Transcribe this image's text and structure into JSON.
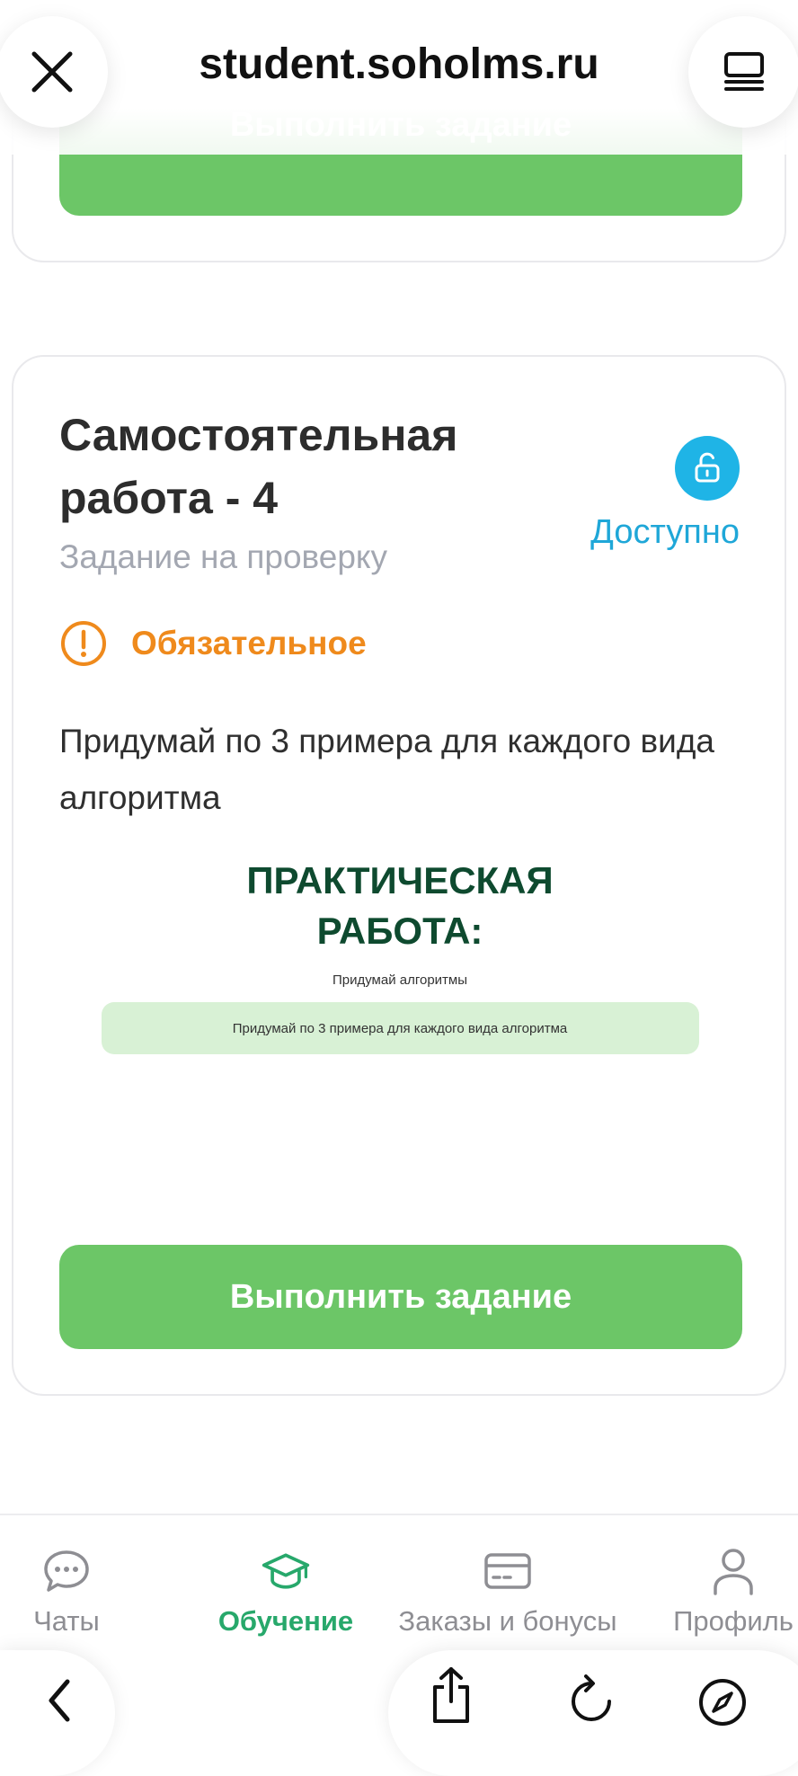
{
  "browser": {
    "domain": "student.soholms.ru",
    "close_icon": "close-icon",
    "tabs_icon": "tabs-icon"
  },
  "prev_card": {
    "button_label": "Выполнить задание"
  },
  "task_card": {
    "title": "Самостоятельная работа - 4",
    "subtitle": "Задание на проверку",
    "status_label": "Доступно",
    "status_icon": "unlock-icon",
    "mandatory_label": "Обязательное",
    "mandatory_icon": "alert-circle-icon",
    "description": "Придумай по 3 примера для каждого вида алгоритма",
    "preview": {
      "heading": "ПРАКТИЧЕСКАЯ РАБОТА:",
      "subheading": "Придумай алгоритмы",
      "box_text": "Придумай по 3 примера для каждого вида алгоритма"
    },
    "button_label": "Выполнить задание"
  },
  "bottom_nav": {
    "items": [
      {
        "label": "Чаты",
        "icon": "chat-bubble-icon",
        "active": false
      },
      {
        "label": "Обучение",
        "icon": "graduation-cap-icon",
        "active": true
      },
      {
        "label": "Заказы и бонусы",
        "icon": "card-icon",
        "active": false
      },
      {
        "label": "Профиль",
        "icon": "user-icon",
        "active": false
      }
    ]
  },
  "toolbar": {
    "icons": [
      "back-icon",
      "share-icon",
      "reload-icon",
      "compass-icon"
    ]
  },
  "colors": {
    "accent_green": "#6cc667",
    "active_nav": "#27a86b",
    "status_blue": "#1fb4e6",
    "warning_orange": "#ef8a1c",
    "preview_heading": "#0e4a2f"
  }
}
